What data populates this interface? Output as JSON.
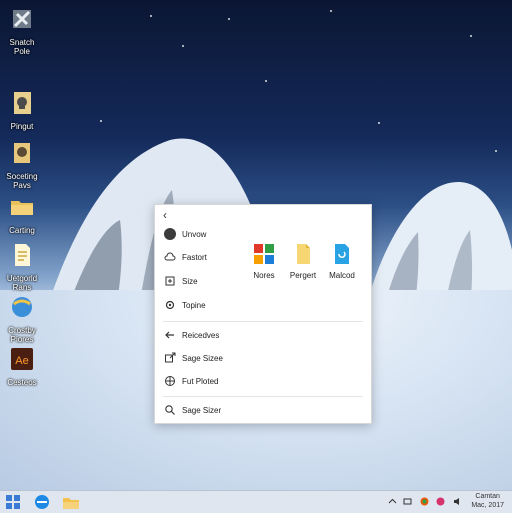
{
  "desktop": {
    "icons": [
      {
        "label": "Snatch Pole",
        "icon": "app-icon"
      },
      {
        "label": "Pingut",
        "icon": "skull-file-icon"
      },
      {
        "label": "Soceting Pavs",
        "icon": "folder-file-icon"
      },
      {
        "label": "Carting",
        "icon": "folder-icon"
      },
      {
        "label": "Uetgorld Rans",
        "icon": "document-icon"
      },
      {
        "label": "Crostby Plores",
        "icon": "browser-icon"
      },
      {
        "label": "Cesteos",
        "icon": "adobe-icon"
      }
    ]
  },
  "menu": {
    "back": "‹",
    "items": [
      {
        "label": "Unvow",
        "icon": "user-icon"
      },
      {
        "label": "Fastort",
        "icon": "cloud-icon"
      },
      {
        "label": "Size",
        "icon": "resize-icon"
      },
      {
        "label": "Topine",
        "icon": "gear-icon"
      },
      {
        "label": "Reicedves",
        "icon": "arrow-left-icon"
      },
      {
        "label": "Sage Sizee",
        "icon": "external-icon"
      },
      {
        "label": "Fut Ploted",
        "icon": "globe-icon"
      },
      {
        "label": "Sage Sizer",
        "icon": "search-icon"
      }
    ],
    "tiles": [
      {
        "label": "Nores",
        "icon": "tile-grid-icon"
      },
      {
        "label": "Pergert",
        "icon": "document-icon"
      },
      {
        "label": "Malcod",
        "icon": "app-blue-icon"
      }
    ]
  },
  "taskbar": {
    "clock_line1": "Camtan",
    "clock_line2": "Mac, 2017"
  }
}
